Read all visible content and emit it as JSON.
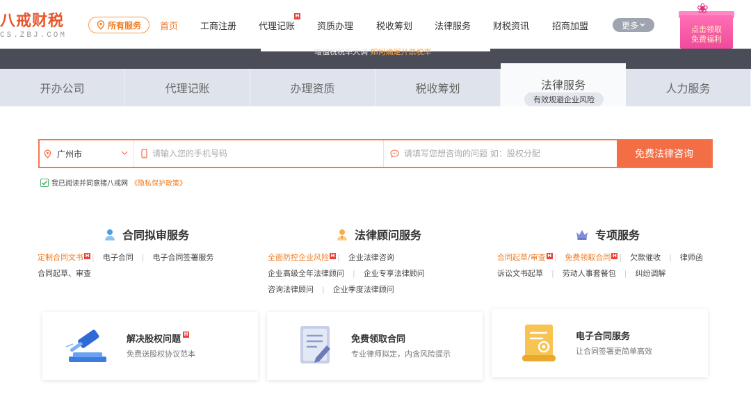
{
  "header": {
    "logo_text": "八戒财税",
    "logo_sub": "CS.ZBJ.COM",
    "all_services": "所有服务",
    "nav": [
      {
        "label": "首页",
        "active": true,
        "hot": false
      },
      {
        "label": "工商注册",
        "active": false,
        "hot": false
      },
      {
        "label": "代理记账",
        "active": false,
        "hot": true
      },
      {
        "label": "资质办理",
        "active": false,
        "hot": false
      },
      {
        "label": "税收筹划",
        "active": false,
        "hot": false
      },
      {
        "label": "法律服务",
        "active": false,
        "hot": false
      },
      {
        "label": "财税资讯",
        "active": false,
        "hot": false
      },
      {
        "label": "招商加盟",
        "active": false,
        "hot": false
      }
    ],
    "more": "更多",
    "promo_line1": "点击领取",
    "promo_line2": "免费福利",
    "hot_badge": "H"
  },
  "banner": {
    "text": "增值税税率大调",
    "link": "如何确定开票税率"
  },
  "tabs": [
    {
      "label": "开办公司",
      "active": false
    },
    {
      "label": "代理记账",
      "active": false
    },
    {
      "label": "办理资质",
      "active": false
    },
    {
      "label": "税收筹划",
      "active": false
    },
    {
      "label": "法律服务",
      "active": true,
      "sub": "有效规避企业风险"
    },
    {
      "label": "人力服务",
      "active": false
    }
  ],
  "form": {
    "city": "广州市",
    "phone_placeholder": "请输入您的手机号码",
    "question_placeholder": "请填写您想咨询的问题 如：股权分配",
    "submit": "免费法律咨询",
    "agree_text": "我已阅读并同意猪八戒网",
    "agree_policy": "《隐私保护政策》"
  },
  "columns": [
    {
      "title": "合同拟审服务",
      "icon": "person-icon",
      "rows": [
        [
          {
            "t": "定制合同文书",
            "orange": true,
            "hot": true
          },
          {
            "t": "电子合同"
          },
          {
            "t": "电子合同签署服务"
          }
        ],
        [
          {
            "t": "合同起草、审查"
          }
        ]
      ]
    },
    {
      "title": "法律顾问服务",
      "icon": "lawyer-icon",
      "rows": [
        [
          {
            "t": "全面防控企业风险",
            "orange": true,
            "hot": true
          },
          {
            "t": "企业法律咨询"
          }
        ],
        [
          {
            "t": "企业高级全年法律顾问"
          },
          {
            "t": "企业专享法律顾问"
          }
        ],
        [
          {
            "t": "咨询法律顾问"
          },
          {
            "t": "企业季度法律顾问"
          }
        ]
      ]
    },
    {
      "title": "专项服务",
      "icon": "crown-icon",
      "rows": [
        [
          {
            "t": "合同起草/审查",
            "orange": true,
            "hot": true
          },
          {
            "t": "免费领取合同",
            "orange": true,
            "hot": true
          },
          {
            "t": "欠款催收"
          },
          {
            "t": "律师函"
          }
        ],
        [
          {
            "t": "诉讼文书起草"
          },
          {
            "t": "劳动人事套餐包"
          },
          {
            "t": "纠纷调解"
          }
        ]
      ]
    }
  ],
  "cards": [
    {
      "title": "解决股权问题",
      "desc": "免费送股权协议范本",
      "hot": true,
      "icon": "gavel-icon"
    },
    {
      "title": "免费领取合同",
      "desc": "专业律师拟定，内含风险提示",
      "hot": false,
      "icon": "document-edit-icon"
    },
    {
      "title": "电子合同服务",
      "desc": "让合同签署更简单高效",
      "hot": false,
      "icon": "scroll-icon"
    }
  ]
}
